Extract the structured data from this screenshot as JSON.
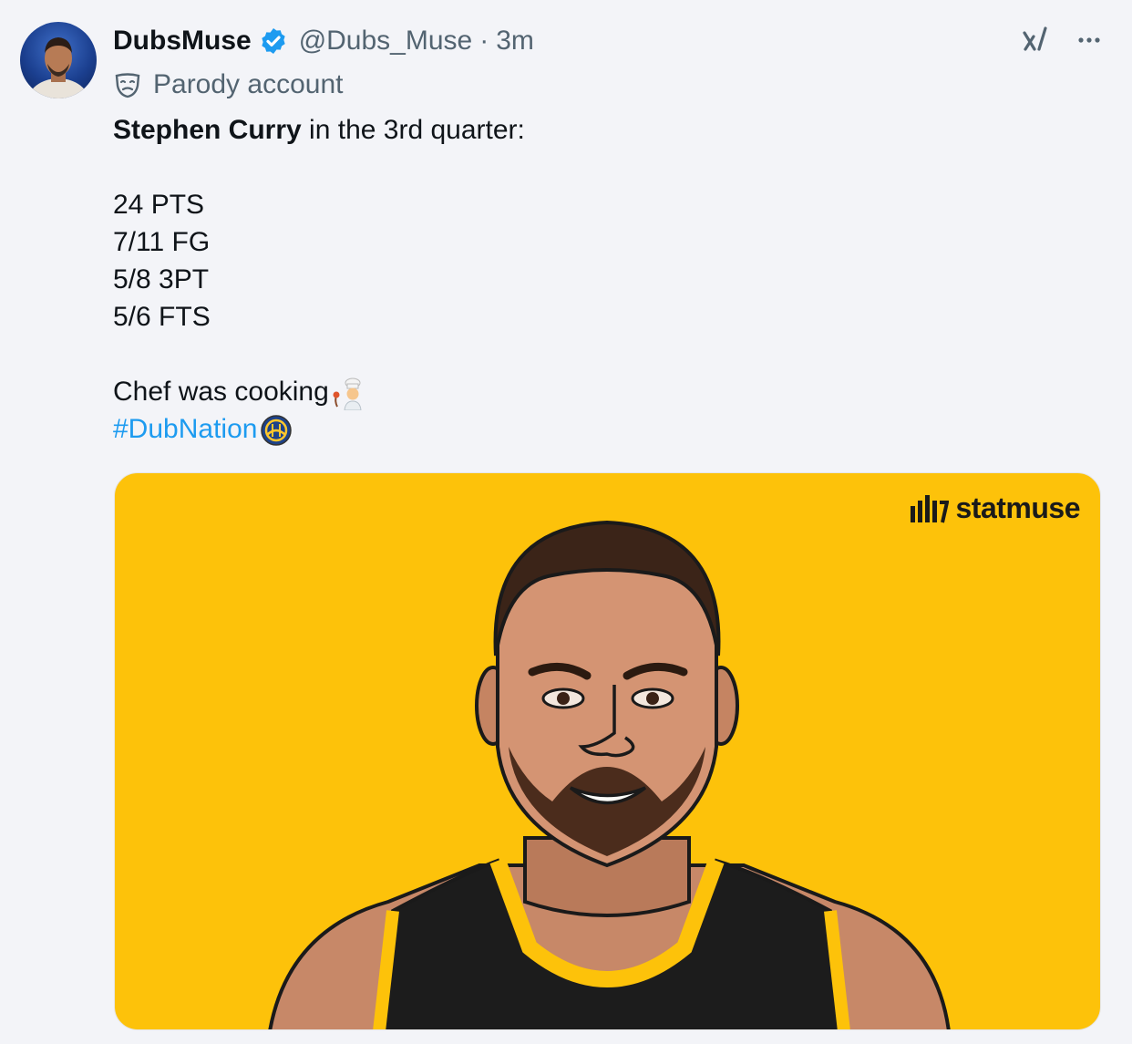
{
  "post": {
    "display_name": "DubsMuse",
    "handle": "@Dubs_Muse",
    "separator": "·",
    "time": "3m",
    "badge_label": "Parody account",
    "text": {
      "player_name": "Stephen Curry",
      "intro_rest": " in the 3rd quarter:",
      "stats": [
        "24 PTS",
        "7/11 FG",
        "5/8 3PT",
        "5/6 FTS"
      ],
      "closing": "Chef was cooking",
      "hashtag": "#DubNation"
    },
    "media": {
      "brand": "statmuse",
      "background_color": "#fdc20a"
    },
    "icons": {
      "verified": "verified-badge-icon",
      "grok": "grok-icon",
      "more": "more-icon",
      "parody": "mask-icon",
      "emoji_closing": "cook-emoji-icon",
      "emoji_hashtag": "warriors-logo-icon"
    },
    "colors": {
      "link": "#1d9bf0",
      "secondary_text": "#536471",
      "primary_text": "#0f1419"
    }
  }
}
